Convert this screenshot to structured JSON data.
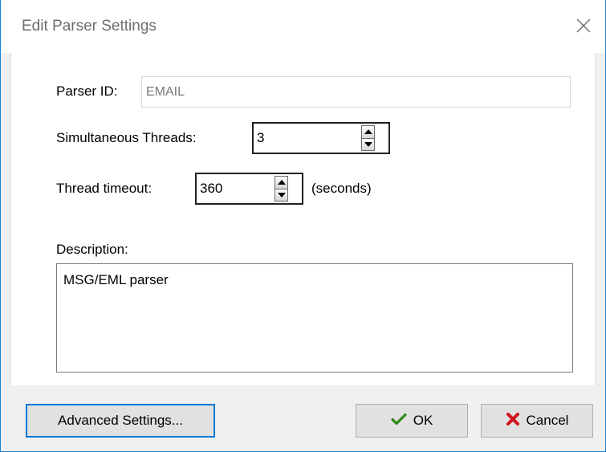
{
  "window": {
    "title": "Edit Parser Settings"
  },
  "form": {
    "parser_id_label": "Parser ID:",
    "parser_id_value": "EMAIL",
    "threads_label": "Simultaneous Threads:",
    "threads_value": "3",
    "timeout_label": "Thread timeout:",
    "timeout_value": "360",
    "timeout_unit": "(seconds)",
    "description_label": "Description:",
    "description_value": "MSG/EML parser"
  },
  "buttons": {
    "advanced_label": "Advanced Settings...",
    "ok_label": "OK",
    "cancel_label": "Cancel"
  },
  "icons": {
    "close": "close-icon",
    "ok": "checkmark-icon",
    "cancel": "red-x-icon"
  },
  "colors": {
    "accent_border": "#0078d7",
    "ok_icon": "#2e8b1c",
    "cancel_icon": "#d0141e"
  }
}
